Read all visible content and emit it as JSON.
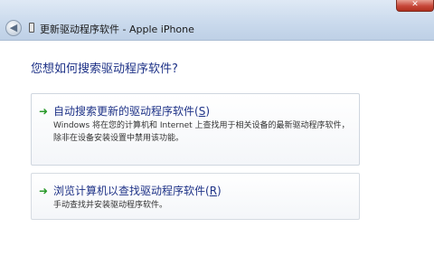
{
  "window": {
    "back_symbol": "◀",
    "title": "更新驱动程序软件 - Apple iPhone",
    "close_symbol": "✕"
  },
  "page": {
    "question": "您想如何搜索驱动程序软件?"
  },
  "options": [
    {
      "title_main": "自动搜索更新的驱动程序软件(",
      "title_key": "S",
      "title_end": ")",
      "description": "Windows 将在您的计算机和 Internet 上查找用于相关设备的最新驱动程序软件，除非在设备安装设置中禁用该功能。"
    },
    {
      "title_main": "浏览计算机以查找驱动程序软件(",
      "title_key": "R",
      "title_end": ")",
      "description": "手动查找并安装驱动程序软件。"
    }
  ],
  "colors": {
    "link_blue": "#1e3287",
    "arrow_green": "#2a9a2a"
  }
}
